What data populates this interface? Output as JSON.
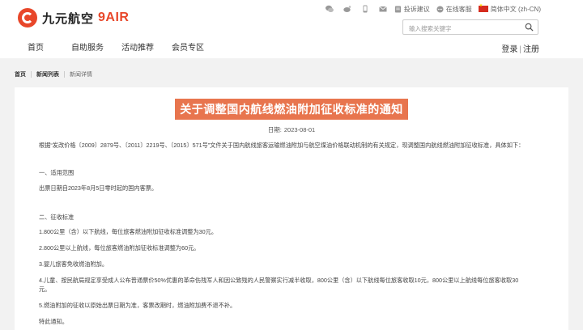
{
  "brand": {
    "name_cn": "九元航空",
    "name_en": "9AIR",
    "color": "#e8472a"
  },
  "topbar": {
    "icons": [
      "wechat-icon",
      "weibo-icon",
      "mobile-icon",
      "mail-icon"
    ],
    "feedback": "投诉建议",
    "online_service": "在线客服",
    "language": "简体中文 (zh-CN)"
  },
  "search": {
    "placeholder": "输入搜索关键字"
  },
  "nav": {
    "items": [
      "首页",
      "自助服务",
      "活动推荐",
      "会员专区"
    ]
  },
  "auth": {
    "login": "登录",
    "separator": "|",
    "register": "注册"
  },
  "breadcrumb": {
    "home": "首页",
    "list": "新闻列表",
    "current": "新闻详情"
  },
  "article": {
    "title": "关于调整国内航线燃油附加征收标准的通知",
    "date_label": "日期:",
    "date": "2023-08-01",
    "paragraphs": [
      "根据“发改价格〔2009〕2879号、〔2011〕2219号、〔2015〕571号”文件关于国内航线旅客运输燃油附加与航空煤油价格联动机制的有关规定，现调整国内航线燃油附加征收标准，具体如下：",
      "一、适用范围",
      "出票日期自2023年8月5日零时起的国内客票。",
      "二、征收标准",
      "1.800公里（含）以下航线，每位旅客燃油附加征收标准调整为30元。",
      "2.800公里以上航线，每位旅客燃油附加征收标准调整为60元。",
      "3.婴儿旅客免收燃油附加。",
      "4.儿童、按民航局规定享受成人公布普通票价50%优惠的革命伤残军人和因公致残的人民警察实行减半收取，800公里（含）以下航线每位旅客收取10元，800公里以上航线每位旅客收取30元。",
      "5.燃油附加的征收以原始出票日期为准，客票改期时，燃油附加费不退不补。",
      "特此通知。"
    ]
  }
}
